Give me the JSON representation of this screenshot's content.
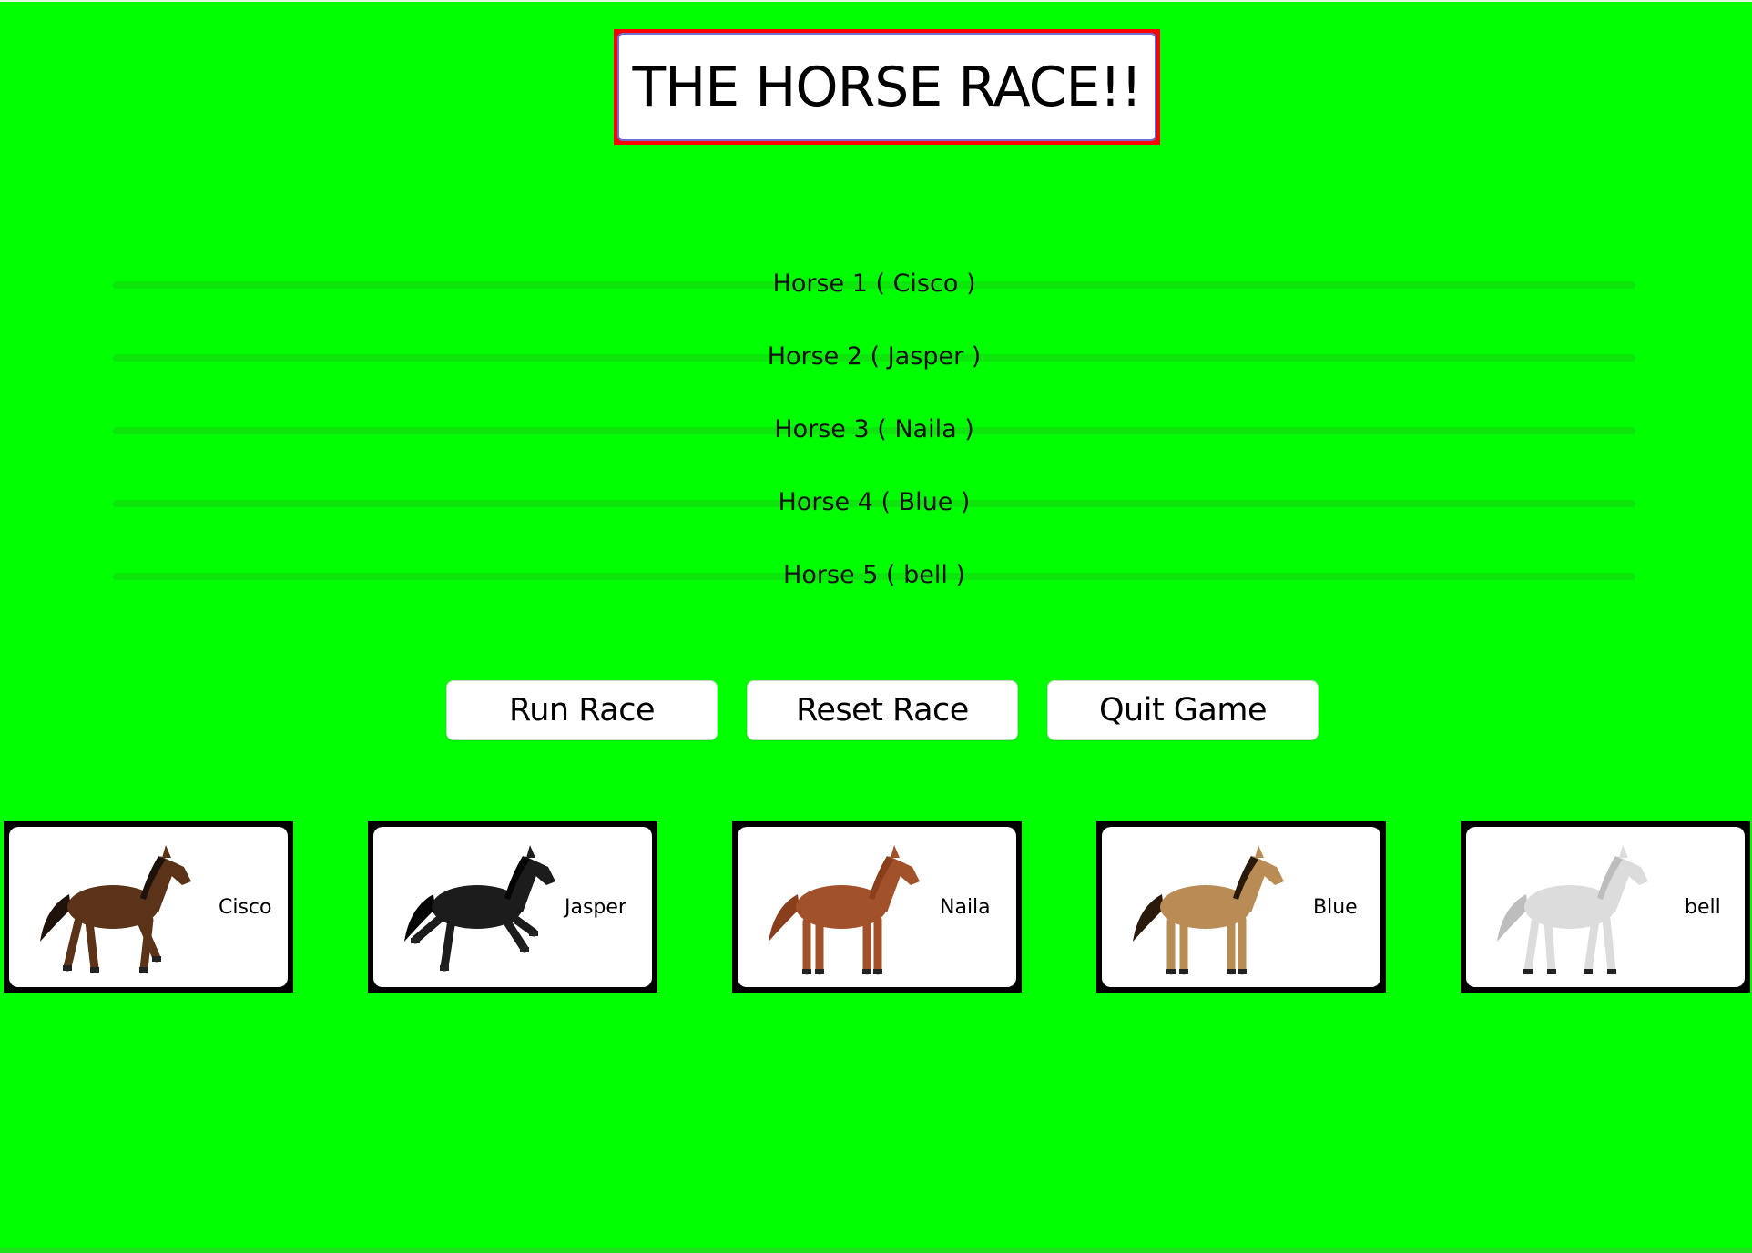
{
  "window": {
    "title": "THE HORSE RACE!!"
  },
  "tracks": [
    {
      "label": "Horse 1 ( Cisco )",
      "progress": 0
    },
    {
      "label": "Horse 2 ( Jasper )",
      "progress": 0
    },
    {
      "label": "Horse 3 ( Naila )",
      "progress": 0
    },
    {
      "label": "Horse 4 ( Blue )",
      "progress": 0
    },
    {
      "label": "Horse 5 ( bell )",
      "progress": 0
    }
  ],
  "buttons": {
    "run": "Run Race",
    "reset": "Reset Race",
    "quit": "Quit Game"
  },
  "horses": [
    {
      "name": "Cisco",
      "coat": "#5a3318",
      "mane": "#1f120a"
    },
    {
      "name": "Jasper",
      "coat": "#1c1c1c",
      "mane": "#050505"
    },
    {
      "name": "Naila",
      "coat": "#a2522a",
      "mane": "#8a3f1c"
    },
    {
      "name": "Blue",
      "coat": "#b98c56",
      "mane": "#2a1a0c"
    },
    {
      "name": "bell",
      "coat": "#dcdcdc",
      "mane": "#bdbdbd"
    }
  ],
  "colors": {
    "background": "#00ff00",
    "title_border": "#ff0000",
    "card_border": "#000000"
  }
}
